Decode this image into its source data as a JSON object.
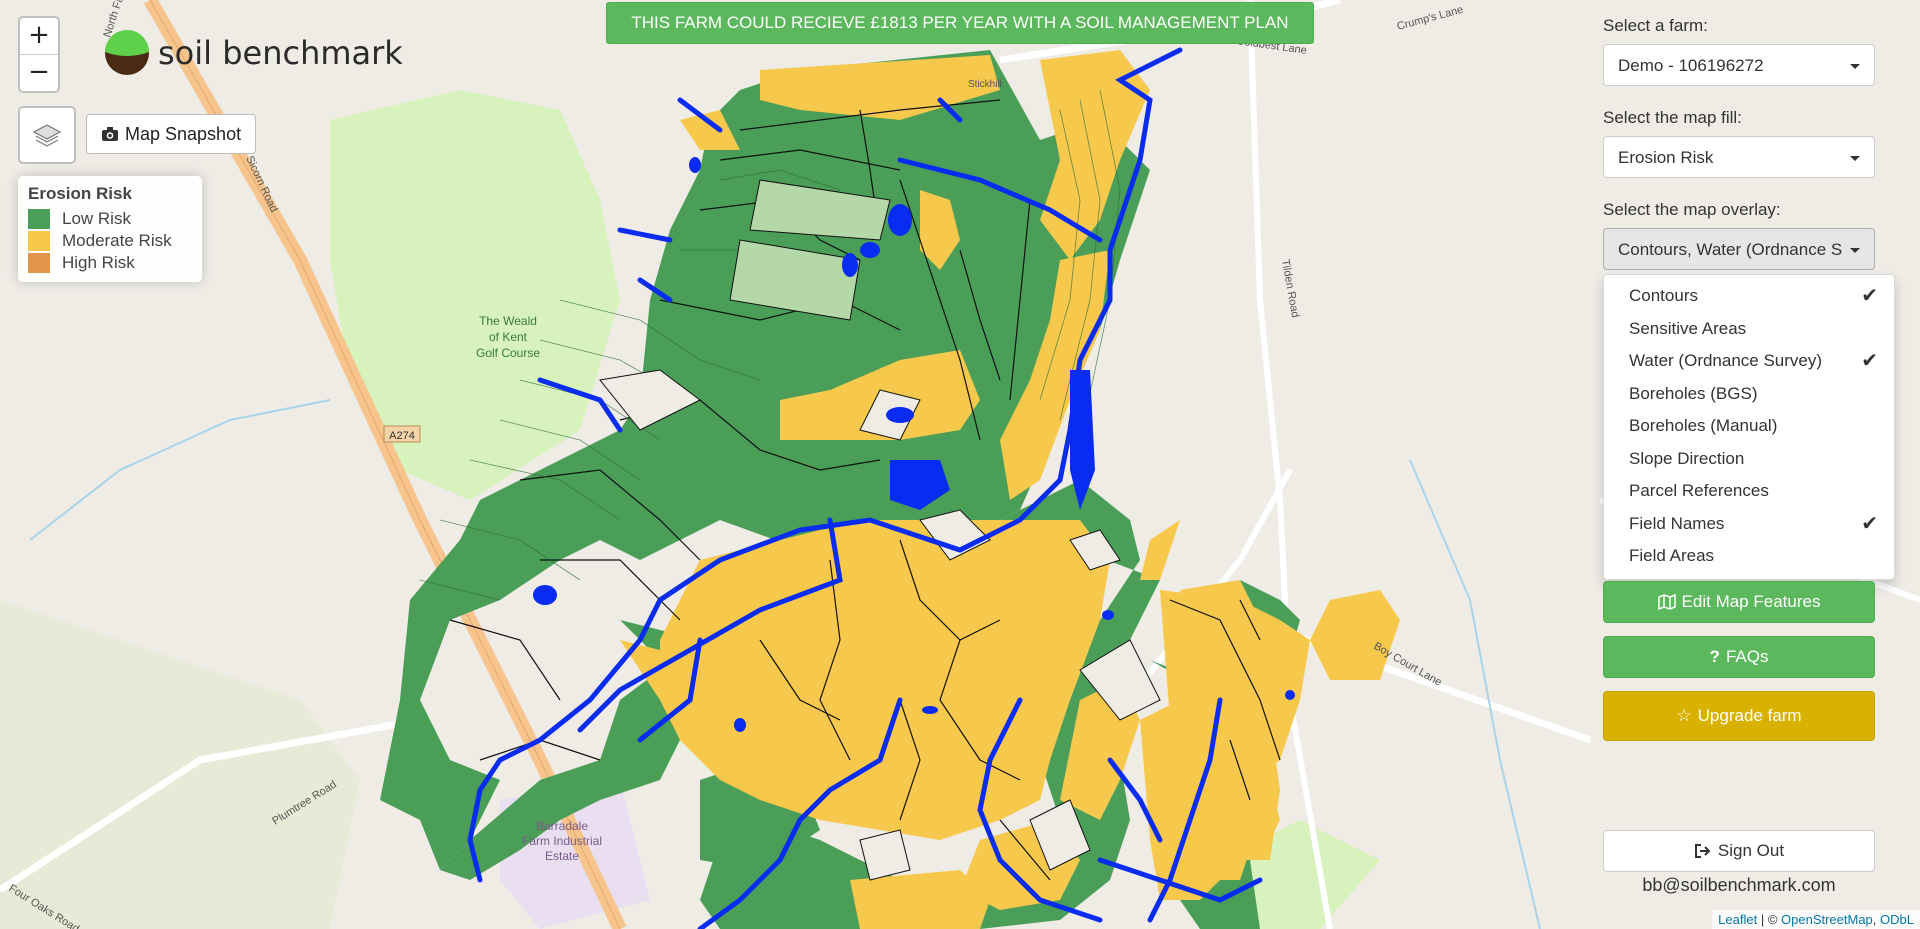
{
  "banner": {
    "text": "THIS FARM COULD RECIEVE £1813 PER YEAR WITH A SOIL MANAGEMENT PLAN"
  },
  "zoom": {
    "in": "+",
    "out": "−"
  },
  "logo": {
    "text": "soil benchmark"
  },
  "snapshot": {
    "label": "Map Snapshot",
    "icon": "camera-icon"
  },
  "legend": {
    "title": "Erosion Risk",
    "items": [
      {
        "label": "Low Risk",
        "color": "#4a9e57"
      },
      {
        "label": "Moderate Risk",
        "color": "#f6c84b"
      },
      {
        "label": "High Risk",
        "color": "#e0954a"
      }
    ]
  },
  "map_labels": {
    "golf": [
      "The Weald",
      "of Kent",
      "Golf Course"
    ],
    "road_a274": "A274",
    "estate": [
      "Barradale",
      "Farm Industrial",
      "Estate"
    ],
    "plumtree": "Plumtree Road",
    "four_oaks": "Four Oaks Road",
    "boy_court": "Boy Court Lane",
    "tilden": "Tilden Road",
    "crumps": "Crump's Lane",
    "sisskorn": "Sicorn Road",
    "colestreet": "Coldbest Lane",
    "stick": "Stickhill",
    "north_farm": "North Farm Road"
  },
  "sidebar": {
    "farm_label": "Select a farm:",
    "farm_value": "Demo - 106196272",
    "fill_label": "Select the map fill:",
    "fill_value": "Erosion Risk",
    "overlay_label": "Select the map overlay:",
    "overlay_value": "Contours, Water (Ordnance S",
    "overlay_options": [
      {
        "label": "Contours",
        "checked": true
      },
      {
        "label": "Sensitive Areas",
        "checked": false
      },
      {
        "label": "Water (Ordnance Survey)",
        "checked": true
      },
      {
        "label": "Boreholes (BGS)",
        "checked": false
      },
      {
        "label": "Boreholes (Manual)",
        "checked": false
      },
      {
        "label": "Slope Direction",
        "checked": false
      },
      {
        "label": "Parcel References",
        "checked": false
      },
      {
        "label": "Field Names",
        "checked": true
      },
      {
        "label": "Field Areas",
        "checked": false
      }
    ],
    "edit_label": "Edit Map Features",
    "faq_label": "FAQs",
    "upgrade_label": "Upgrade farm",
    "signout_label": "Sign Out",
    "email": "bb@soilbenchmark.com"
  },
  "attribution": {
    "leaflet": "Leaflet",
    "sep": " | © ",
    "osm": "OpenStreetMap",
    "odbl": "ODbL"
  }
}
